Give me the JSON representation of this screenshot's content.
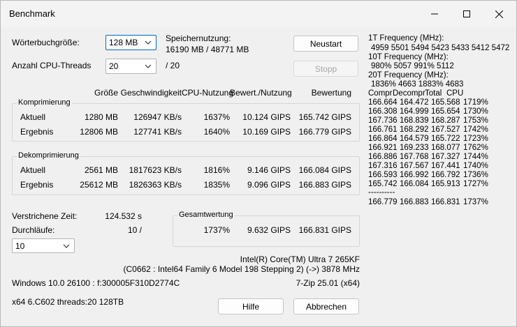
{
  "window": {
    "title": "Benchmark"
  },
  "left": {
    "dict_label": "Wörterbuchgröße:",
    "dict_value": "128 MB",
    "threads_label": "Anzahl CPU-Threads",
    "threads_value": "20",
    "threads_max": "/ 20",
    "mem_label": "Speichernutzung:",
    "mem_value": "16190 MB / 48771 MB",
    "restart_button": "Neustart",
    "stop_button": "Stopp"
  },
  "headers": {
    "size": "Größe",
    "speed": "Geschwindigkeit",
    "cpu": "CPU-Nutzung",
    "rating_usage": "Bewert./Nutzung",
    "rating": "Bewertung"
  },
  "compression": {
    "label": "Komprimierung",
    "rows": [
      {
        "name": "Aktuell",
        "size": "1280 MB",
        "speed": "126947 KB/s",
        "cpu": "1637%",
        "ru": "10.124 GIPS",
        "rating": "165.742 GIPS"
      },
      {
        "name": "Ergebnis",
        "size": "12806 MB",
        "speed": "127741 KB/s",
        "cpu": "1640%",
        "ru": "10.169 GIPS",
        "rating": "166.779 GIPS"
      }
    ]
  },
  "decompression": {
    "label": "Dekomprimierung",
    "rows": [
      {
        "name": "Aktuell",
        "size": "2561 MB",
        "speed": "1817623 KB/s",
        "cpu": "1816%",
        "ru": "9.146 GIPS",
        "rating": "166.084 GIPS"
      },
      {
        "name": "Ergebnis",
        "size": "25612 MB",
        "speed": "1826363 KB/s",
        "cpu": "1835%",
        "ru": "9.096 GIPS",
        "rating": "166.883 GIPS"
      }
    ]
  },
  "elapsed": {
    "label": "Verstrichene Zeit:",
    "value": "124.532 s"
  },
  "passes": {
    "label": "Durchläufe:",
    "value": "10 /",
    "select_value": "10"
  },
  "total": {
    "label": "Gesamtwertung",
    "cpu": "1737%",
    "ru": "9.632 GIPS",
    "rating": "166.831 GIPS"
  },
  "cpuinfo": {
    "line1": "Intel(R) Core(TM) Ultra 7 265KF",
    "line2": "(C0662 : Intel64 Family 6 Model 198 Stepping 2) (->) 3878 MHz"
  },
  "footer": {
    "os": "Windows 10.0 26100 : f:300005F310D2774C",
    "version": "7-Zip 25.01 (x64)",
    "build": "x64 6.C602 threads:20 128TB",
    "help_button": "Hilfe",
    "cancel_button": "Abbrechen"
  },
  "right": {
    "freq1_label": "1T Frequency (MHz):",
    "freq1_values": "4959 5501 5494 5423 5433 5412 5472",
    "freq10_label": "10T Frequency (MHz):",
    "freq10_values": "980% 5057 991% 5112",
    "freq20_label": "20T Frequency (MHz):",
    "freq20_values": "1836% 4663 1883% 4683",
    "table_header": [
      "Compr",
      "Decompr",
      "Total",
      "CPU"
    ],
    "rows": [
      [
        "166.664",
        "164.472",
        "165.568",
        "1719%"
      ],
      [
        "166.308",
        "164.999",
        "165.654",
        "1730%"
      ],
      [
        "167.736",
        "168.839",
        "168.287",
        "1753%"
      ],
      [
        "166.761",
        "168.292",
        "167.527",
        "1742%"
      ],
      [
        "166.864",
        "164.579",
        "165.722",
        "1723%"
      ],
      [
        "166.921",
        "169.233",
        "168.077",
        "1762%"
      ],
      [
        "166.886",
        "167.768",
        "167.327",
        "1744%"
      ],
      [
        "167.316",
        "167.567",
        "167.441",
        "1740%"
      ],
      [
        "166.593",
        "166.992",
        "166.792",
        "1736%"
      ],
      [
        "165.742",
        "166.084",
        "165.913",
        "1727%"
      ]
    ],
    "separator": "----------",
    "summary": [
      "166.779",
      "166.883",
      "166.831",
      "1737%"
    ]
  }
}
